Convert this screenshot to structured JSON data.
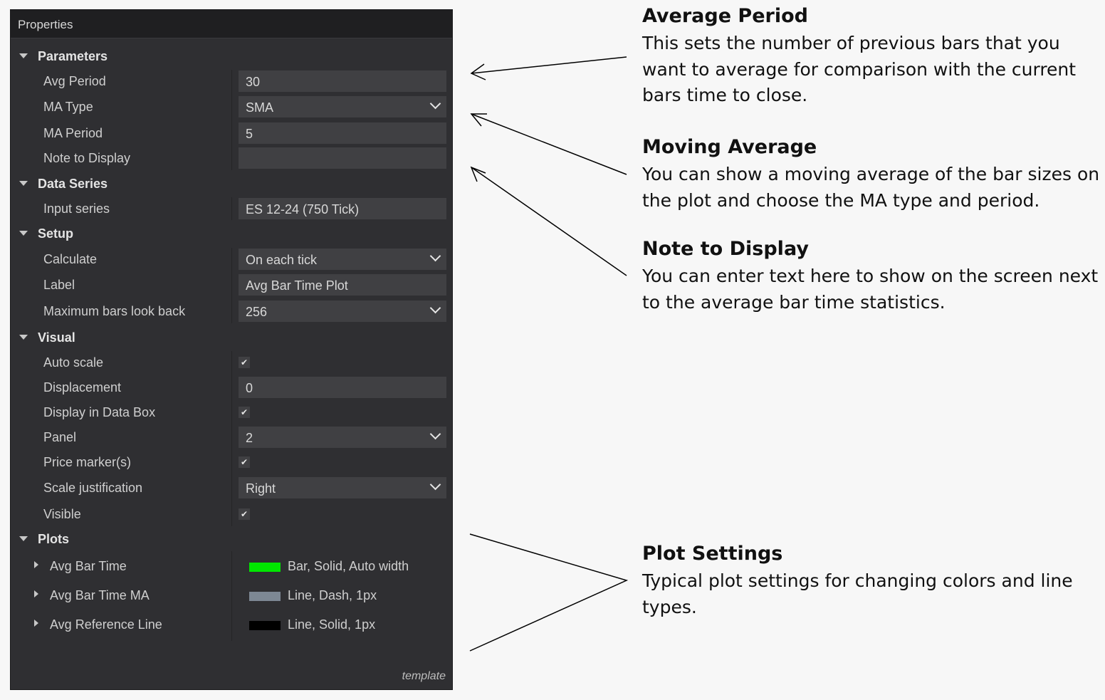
{
  "panel": {
    "title": "Properties",
    "categories": [
      {
        "label": "Parameters",
        "items": [
          {
            "label": "Avg Period",
            "value": "30",
            "type": "text"
          },
          {
            "label": "MA Type",
            "value": "SMA",
            "type": "dropdown"
          },
          {
            "label": "MA Period",
            "value": "5",
            "type": "text"
          },
          {
            "label": "Note to Display",
            "value": "",
            "type": "text"
          }
        ]
      },
      {
        "label": "Data Series",
        "items": [
          {
            "label": "Input series",
            "value": "ES 12-24 (750 Tick)",
            "type": "text"
          }
        ]
      },
      {
        "label": "Setup",
        "items": [
          {
            "label": "Calculate",
            "value": "On each tick",
            "type": "dropdown"
          },
          {
            "label": "Label",
            "value": "Avg Bar Time Plot",
            "type": "text"
          },
          {
            "label": "Maximum bars look back",
            "value": "256",
            "type": "dropdown"
          }
        ]
      },
      {
        "label": "Visual",
        "items": [
          {
            "label": "Auto scale",
            "checked": true,
            "type": "checkbox"
          },
          {
            "label": "Displacement",
            "value": "0",
            "type": "text"
          },
          {
            "label": "Display in Data Box",
            "checked": true,
            "type": "checkbox"
          },
          {
            "label": "Panel",
            "value": "2",
            "type": "dropdown"
          },
          {
            "label": "Price marker(s)",
            "checked": true,
            "type": "checkbox"
          },
          {
            "label": "Scale justification",
            "value": "Right",
            "type": "dropdown"
          },
          {
            "label": "Visible",
            "checked": true,
            "type": "checkbox"
          }
        ]
      },
      {
        "label": "Plots",
        "items": [
          {
            "label": "Avg Bar Time",
            "desc": "Bar, Solid, Auto width",
            "color": "#00e600",
            "type": "plot"
          },
          {
            "label": "Avg Bar Time MA",
            "desc": "Line, Dash, 1px",
            "color": "#7d8894",
            "type": "plot"
          },
          {
            "label": "Avg Reference Line",
            "desc": "Line, Solid, 1px",
            "color": "#000000",
            "type": "plot"
          }
        ]
      }
    ],
    "footer": "template",
    "check_glyph": "✔"
  },
  "notes": [
    {
      "title": "Average Period",
      "lines": [
        "This sets the number of previous bars that you",
        "want to average for comparison with the current",
        "bars time to close."
      ]
    },
    {
      "title": "Moving Average",
      "lines": [
        "You can show a moving average of the bar sizes on",
        "the plot and choose the MA type and period."
      ]
    },
    {
      "title": "Note to Display",
      "lines": [
        "You can enter text here to show on the screen next",
        "to the average bar time statistics."
      ]
    },
    {
      "title": "Plot Settings",
      "lines": [
        "Typical plot settings for changing colors and line",
        "types."
      ]
    }
  ]
}
